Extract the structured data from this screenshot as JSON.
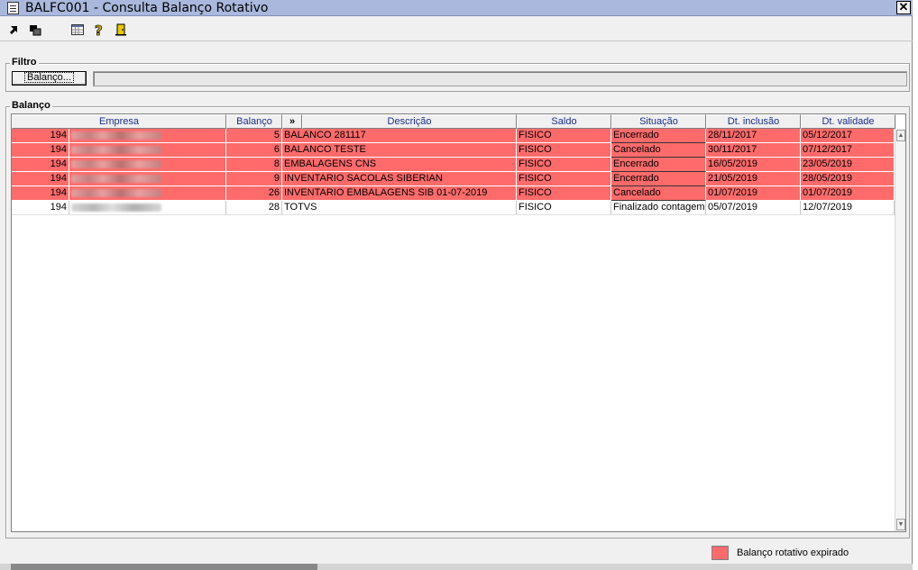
{
  "window": {
    "title": "BALFC001 - Consulta Balanço Rotativo",
    "close_glyph": "✕"
  },
  "toolbar": {
    "icons": [
      "arrow-select-icon",
      "copy-window-icon",
      "calendar-grid-icon",
      "help-icon",
      "exit-door-icon"
    ]
  },
  "filter": {
    "group_label": "Filtro",
    "button_label": "Balanço...",
    "value": ""
  },
  "grid": {
    "group_label": "Balanço",
    "expander_glyph": "»",
    "columns": [
      "Empresa",
      "Balanço",
      "Descrição",
      "Saldo",
      "Situação",
      "Dt. inclusão",
      "Dt. validade"
    ],
    "rows": [
      {
        "empresa": "194",
        "balanco": "5",
        "descricao": "BALANCO 281117",
        "saldo": "FISICO",
        "situacao": "Encerrado",
        "inclusao": "28/11/2017",
        "validade": "05/12/2017",
        "expired": true
      },
      {
        "empresa": "194",
        "balanco": "6",
        "descricao": "BALANCO TESTE",
        "saldo": "FISICO",
        "situacao": "Cancelado",
        "inclusao": "30/11/2017",
        "validade": "07/12/2017",
        "expired": true
      },
      {
        "empresa": "194",
        "balanco": "8",
        "descricao": "EMBALAGENS CNS",
        "saldo": "FISICO",
        "situacao": "Encerrado",
        "inclusao": "16/05/2019",
        "validade": "23/05/2019",
        "expired": true
      },
      {
        "empresa": "194",
        "balanco": "9",
        "descricao": "INVENTARIO SACOLAS SIBERIAN",
        "saldo": "FISICO",
        "situacao": "Encerrado",
        "inclusao": "21/05/2019",
        "validade": "28/05/2019",
        "expired": true
      },
      {
        "empresa": "194",
        "balanco": "26",
        "descricao": "INVENTARIO EMBALAGENS SIB 01-07-2019",
        "saldo": "FISICO",
        "situacao": "Cancelado",
        "inclusao": "01/07/2019",
        "validade": "01/07/2019",
        "expired": true
      },
      {
        "empresa": "194",
        "balanco": "28",
        "descricao": "TOTVS",
        "saldo": "FISICO",
        "situacao": "Finalizado contagem",
        "inclusao": "05/07/2019",
        "validade": "12/07/2019",
        "expired": false
      }
    ]
  },
  "legend": {
    "label": "Balanço rotativo expirado",
    "color": "#ff6b6b"
  }
}
